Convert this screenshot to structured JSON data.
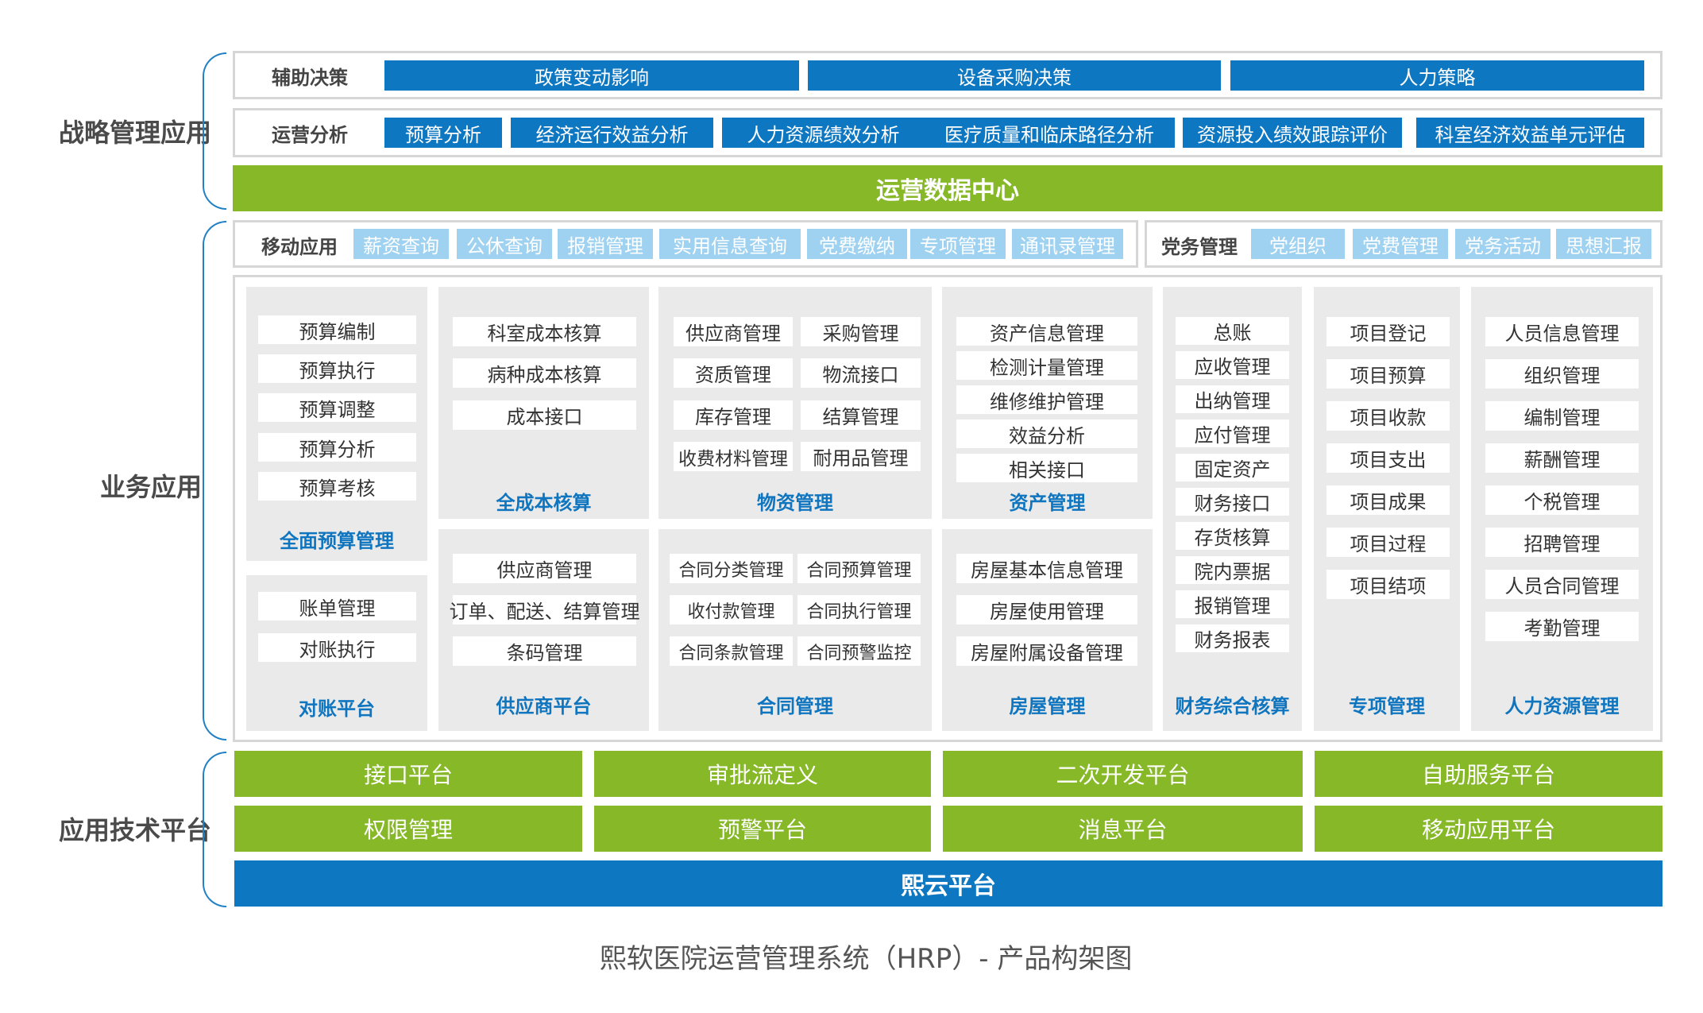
{
  "sections": {
    "strategy": "战略管理应用",
    "business": "业务应用",
    "platform": "应用技术平台"
  },
  "decision": {
    "label": "辅助决策",
    "items": [
      "政策变动影响",
      "设备采购决策",
      "人力策略"
    ]
  },
  "analysis": {
    "label": "运营分析",
    "items": [
      "预算分析",
      "经济运行效益分析",
      "人力资源绩效分析",
      "医疗质量和临床路径分析",
      "资源投入绩效跟踪评价",
      "科室经济效益单元评估"
    ]
  },
  "data_center": "运营数据中心",
  "mobile": {
    "label": "移动应用",
    "items": [
      "薪资查询",
      "公休查询",
      "报销管理",
      "实用信息查询",
      "党费缴纳",
      "专项管理",
      "通讯录管理"
    ]
  },
  "party": {
    "label": "党务管理",
    "items": [
      "党组织",
      "党费管理",
      "党务活动",
      "思想汇报"
    ]
  },
  "modules": {
    "budget": {
      "title": "全面预算管理",
      "items": [
        "预算编制",
        "预算执行",
        "预算调整",
        "预算分析",
        "预算考核"
      ]
    },
    "reconcile": {
      "title": "对账平台",
      "items": [
        "账单管理",
        "对账执行"
      ]
    },
    "cost": {
      "title": "全成本核算",
      "items": [
        "科室成本核算",
        "病种成本核算",
        "成本接口"
      ]
    },
    "supplier": {
      "title": "供应商平台",
      "items": [
        "供应商管理",
        "订单、配送、结算管理",
        "条码管理"
      ]
    },
    "material": {
      "title": "物资管理",
      "items": [
        "供应商管理",
        "采购管理",
        "资质管理",
        "物流接口",
        "库存管理",
        "结算管理",
        "收费材料管理",
        "耐用品管理"
      ]
    },
    "contract": {
      "title": "合同管理",
      "items": [
        "合同分类管理",
        "合同预算管理",
        "收付款管理",
        "合同执行管理",
        "合同条款管理",
        "合同预警监控"
      ]
    },
    "asset": {
      "title": "资产管理",
      "items": [
        "资产信息管理",
        "检测计量管理",
        "维修维护管理",
        "效益分析",
        "相关接口"
      ]
    },
    "house": {
      "title": "房屋管理",
      "items": [
        "房屋基本信息管理",
        "房屋使用管理",
        "房屋附属设备管理"
      ]
    },
    "finance": {
      "title": "财务综合核算",
      "items": [
        "总账",
        "应收管理",
        "出纳管理",
        "应付管理",
        "固定资产",
        "财务接口",
        "存货核算",
        "院内票据",
        "报销管理",
        "财务报表"
      ]
    },
    "project": {
      "title": "专项管理",
      "items": [
        "项目登记",
        "项目预算",
        "项目收款",
        "项目支出",
        "项目成果",
        "项目过程",
        "项目结项"
      ]
    },
    "hr": {
      "title": "人力资源管理",
      "items": [
        "人员信息管理",
        "组织管理",
        "编制管理",
        "薪酬管理",
        "个税管理",
        "招聘管理",
        "人员合同管理",
        "考勤管理"
      ]
    }
  },
  "platform": {
    "row1": [
      "接口平台",
      "审批流定义",
      "二次开发平台",
      "自助服务平台"
    ],
    "row2": [
      "权限管理",
      "预警平台",
      "消息平台",
      "移动应用平台"
    ],
    "base": "熙云平台"
  },
  "caption": "熙软医院运营管理系统（HRP）- 产品构架图",
  "colors": {
    "blue": "#0e77c2",
    "light_blue": "#9fd2f1",
    "green": "#86b828",
    "panel": "#eaeaea",
    "title_blue": "#1075bf"
  }
}
